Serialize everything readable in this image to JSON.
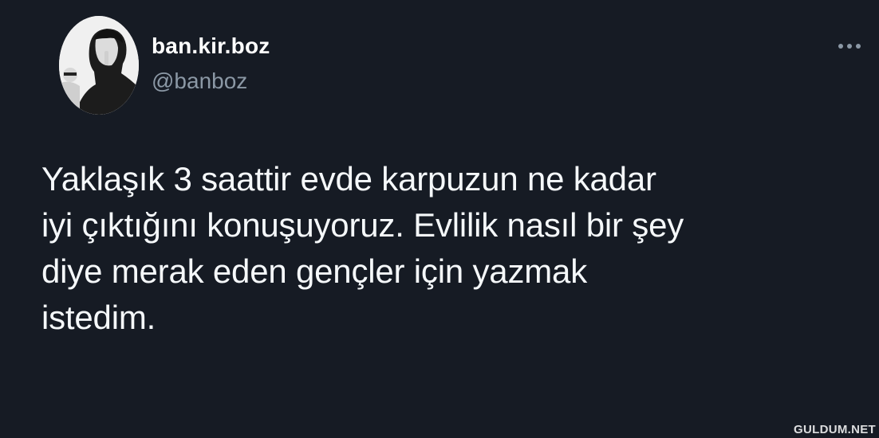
{
  "tweet": {
    "author": {
      "display_name": "ban.kir.boz",
      "handle": "@banboz",
      "avatar": "profile-photo"
    },
    "more_icon": "more-horizontal-icon",
    "text_lines": [
      "Yaklaşık 3 saattir evde karpuzun ne kadar",
      "iyi çıktığını konuşuyoruz. Evlilik nasıl bir şey",
      "diye merak eden gençler için yazmak",
      "istedim."
    ]
  },
  "watermark": "GULDUM.NET",
  "colors": {
    "background": "#161b24",
    "text": "#f5f8fa",
    "secondary_text": "#8b98a5"
  }
}
